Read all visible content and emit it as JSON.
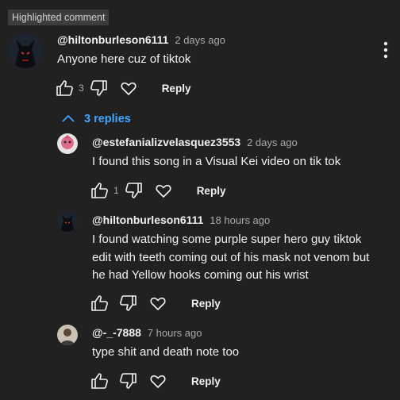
{
  "badge": "Highlighted comment",
  "main_comment": {
    "handle": "@hiltonburleson6111",
    "time": "2 days ago",
    "text": "Anyone here cuz of tiktok",
    "likes": "3",
    "reply_label": "Reply"
  },
  "replies_toggle": {
    "label": "3 replies"
  },
  "replies": [
    {
      "handle": "@estefanializvelasquez3553",
      "time": "2 days ago",
      "text": "I found this song in a Visual Kei video on tik tok",
      "likes": "1",
      "reply_label": "Reply"
    },
    {
      "handle": "@hiltonburleson6111",
      "time": "18 hours ago",
      "text": "I found watching some purple super hero guy tiktok edit with teeth coming out of his mask not venom but he had Yellow hooks coming out his wrist",
      "likes": "",
      "reply_label": "Reply"
    },
    {
      "handle": "@-_-7888",
      "time": "7 hours ago",
      "text": "type shit and death note too",
      "likes": "",
      "reply_label": "Reply"
    }
  ],
  "colors": {
    "background": "#212121",
    "link": "#3ea6ff",
    "muted": "#aaaaaa"
  }
}
